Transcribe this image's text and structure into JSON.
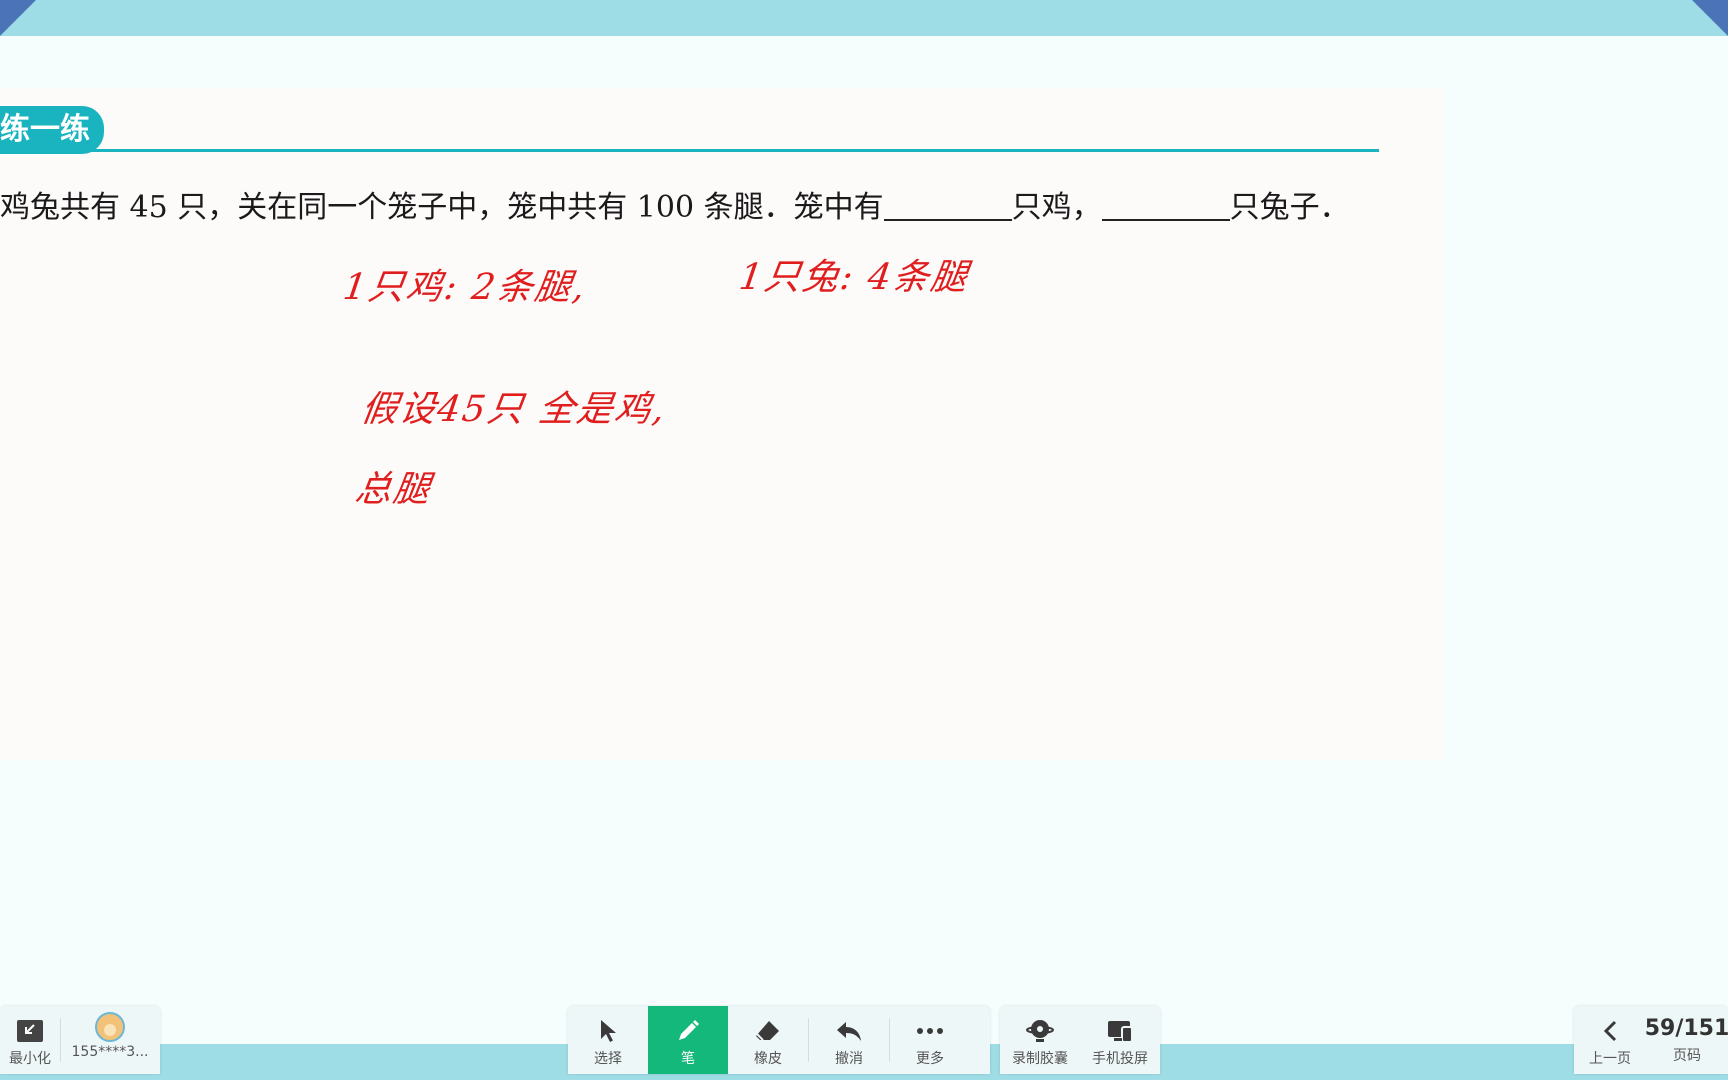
{
  "section": {
    "title": "练一练"
  },
  "question": {
    "part1": "鸡兔共有 45 只，关在同一个笼子中，笼中共有 100 条腿．笼中有",
    "part2": "只鸡，",
    "part3": "只兔子．"
  },
  "handwriting": {
    "line1": "1只鸡: 2条腿,",
    "line2": "1只兔: 4条腿",
    "line3": "假设45只 全是鸡,",
    "line4": "总腿"
  },
  "toolbar_left": {
    "minimize_label": "最小化",
    "user_label": "155****3..."
  },
  "toolbar_center": {
    "select_label": "选择",
    "pen_label": "笔",
    "eraser_label": "橡皮",
    "undo_label": "撤消",
    "more_label": "更多"
  },
  "toolbar_record": {
    "record_label": "录制胶囊",
    "cast_label": "手机投屏"
  },
  "toolbar_right": {
    "prev_label": "上一页",
    "page_value": "59/151",
    "page_label": "页码"
  },
  "colors": {
    "accent": "#19b4bf",
    "pen_active": "#13b87a",
    "ink": "#e01e1e"
  }
}
